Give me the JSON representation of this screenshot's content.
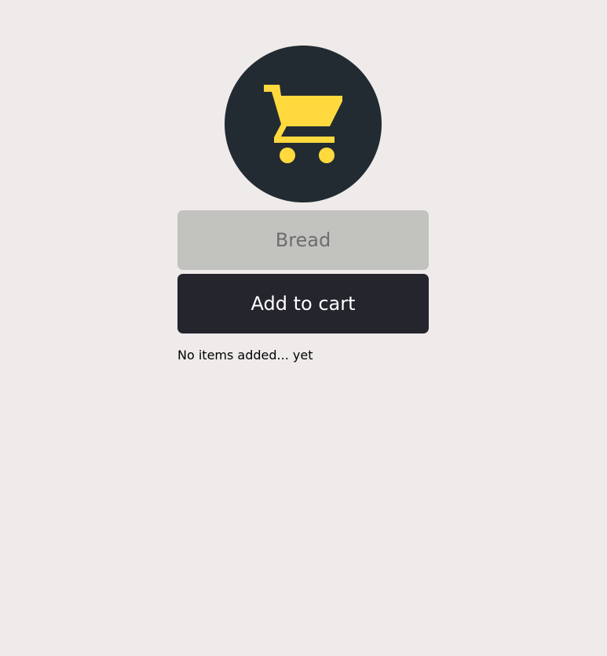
{
  "logo": {
    "icon": "shopping-cart-icon",
    "background_color": "#232b32",
    "icon_color": "#ffd93d"
  },
  "item_input": {
    "value": "",
    "placeholder": "Bread"
  },
  "add_button": {
    "label": "Add to cart",
    "background_color": "#25252e"
  },
  "cart": {
    "empty_message": "No items added... yet"
  }
}
